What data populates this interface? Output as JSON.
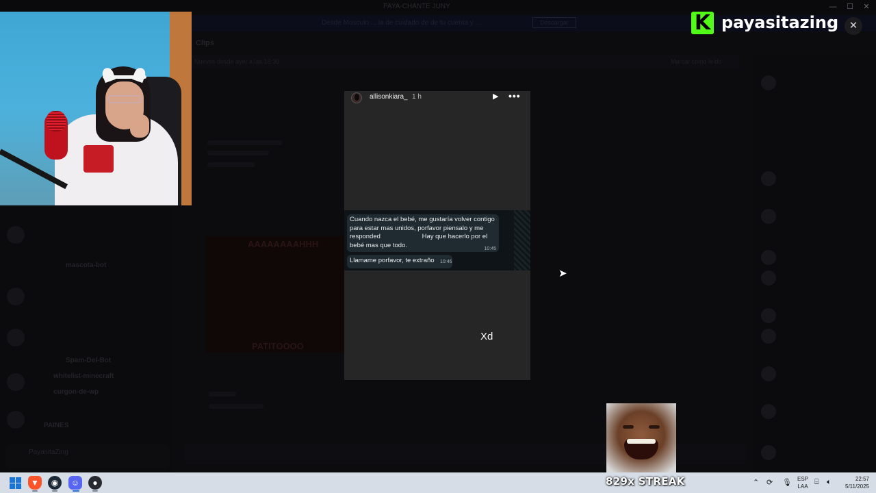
{
  "window": {
    "title": "PAYA-CHANTE JUNY",
    "banner_text": "Desde Mosculo ... la de cuidado de de tu cuenta y ...",
    "banner_button": "Descargar"
  },
  "background": {
    "channel_header": "Clips",
    "subbar_left": "Nuevos desde ayer a las 18:30",
    "subbar_right": "Marcar como leído",
    "channels": [
      "mascota-bot",
      "Spam-Del-Bot",
      "whitelist-minecraft",
      "curgon-de-wp",
      "PAINES"
    ],
    "meme_top": "AAAAAAAAHHH",
    "meme_bottom": "PATITOOOO",
    "user_panel_name": "PayasitaZing"
  },
  "overlay": {
    "brand_name": "payasitazing",
    "brand_logo_letter": "K",
    "close_label": "✕",
    "streak": "829x STREAK"
  },
  "story": {
    "username": "allisonkiara_",
    "time": "1 h",
    "play_icon": "▶",
    "more_icon": "•••",
    "messages": [
      {
        "text": "Cuando nazca el bebé, me gustaría volver contigo\npara estar mas unidos, porfavor piensalo y me\nresponded                       Hay que hacerlo por el\nbebé mas que todo.",
        "time": "10:45"
      },
      {
        "text": "Llamame porfavor, te extraño",
        "time": "10:46"
      }
    ],
    "caption": "Xd"
  },
  "taskbar": {
    "apps": [
      "windows-start",
      "brave",
      "steam",
      "discord",
      "obs"
    ],
    "lang_top": "ESP",
    "lang_bottom": "LAA",
    "clock_time": "22:57",
    "clock_date": "5/11/2025"
  },
  "colors": {
    "kick_green": "#53fc18",
    "story_bg": "#262626",
    "bubble": "#1f2b30",
    "taskbar": "#d6dde7"
  }
}
